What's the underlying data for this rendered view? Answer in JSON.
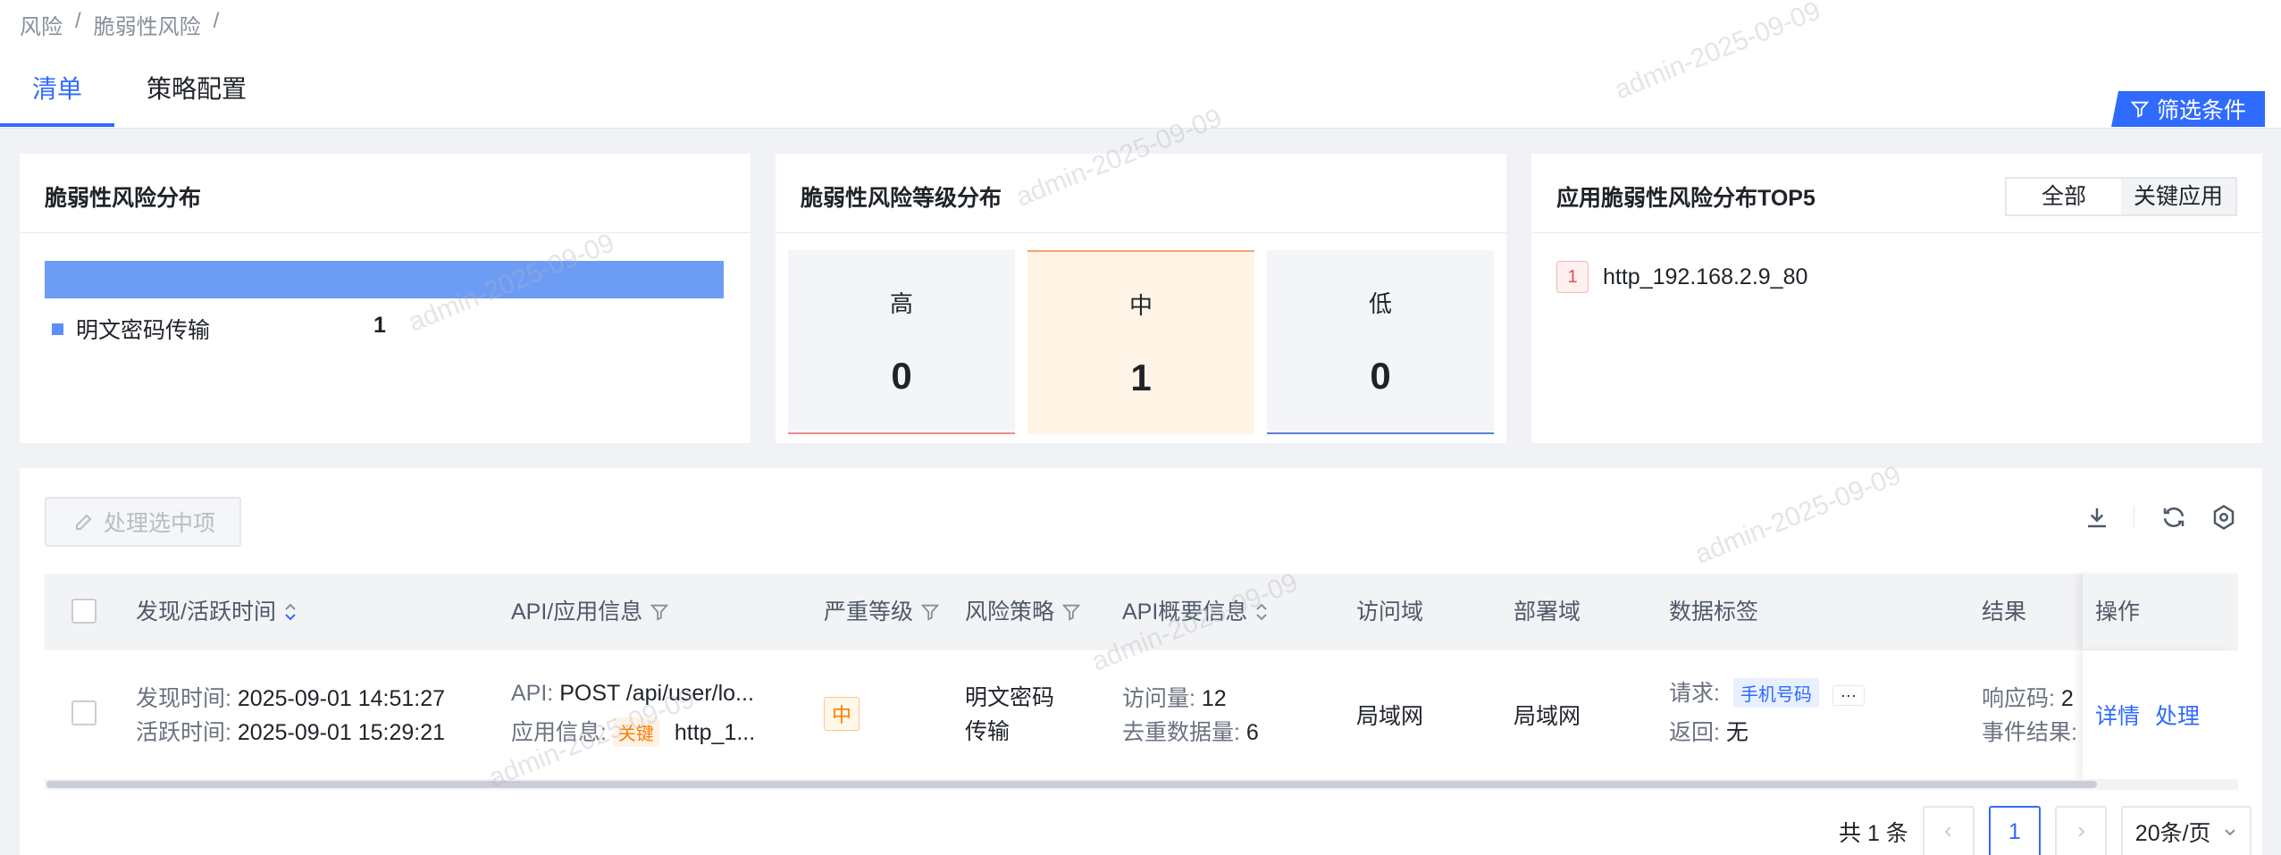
{
  "breadcrumb": [
    "风险",
    "/",
    "脆弱性风险",
    "/"
  ],
  "tabs": [
    {
      "label": "清单",
      "active": true
    },
    {
      "label": "策略配置",
      "active": false
    }
  ],
  "filter_button": {
    "label": "筛选条件"
  },
  "cards": {
    "distribution": {
      "title": "脆弱性风险分布",
      "legend": {
        "label": "明文密码传输",
        "value": "1"
      },
      "color": "#5b8ff9"
    },
    "levels": {
      "title": "脆弱性风险等级分布",
      "items": [
        {
          "label": "高",
          "value": "0",
          "bg": "#f4f5f8",
          "line": "#f08d8d"
        },
        {
          "label": "中",
          "value": "1",
          "bg": "#fff4e6",
          "line": "#f7a46a"
        },
        {
          "label": "低",
          "value": "0",
          "bg": "#f4f5f8",
          "line": "#5b7fe0"
        }
      ]
    },
    "top5": {
      "title": "应用脆弱性风险分布TOP5",
      "segments": [
        "全部",
        "关键应用"
      ],
      "items": [
        {
          "rank": "1",
          "name": "http_192.168.2.9_80"
        }
      ]
    }
  },
  "table": {
    "process_selected": "处理选中项",
    "columns": {
      "time": "发现/活跃时间",
      "api": "API/应用信息",
      "severity": "严重等级",
      "policy": "风险策略",
      "api_summary": "API概要信息",
      "access": "访问域",
      "deploy": "部署域",
      "data_tags": "数据标签",
      "result": "结果",
      "ops": "操作"
    },
    "row": {
      "found_label": "发现时间:",
      "found_time": "2025-09-01 14:51:27",
      "active_label": "活跃时间:",
      "active_time": "2025-09-01 15:29:21",
      "api_label": "API:",
      "api_value": "POST /api/user/lo...",
      "app_label": "应用信息:",
      "app_tag": "关键",
      "app_value": "http_1...",
      "severity": "中",
      "policy_line1": "明文密码",
      "policy_line2": "传输",
      "visits_label": "访问量:",
      "visits": "12",
      "dedup_label": "去重数据量:",
      "dedup": "6",
      "access": "局域网",
      "deploy": "局域网",
      "req_label": "请求:",
      "req_tag": "手机号码",
      "req_more": "···",
      "resp_label": "返回:",
      "resp_value": "无",
      "resp_code_label": "响应码:",
      "resp_code": "2",
      "event_label": "事件结果:",
      "detail": "详情",
      "handle": "处理"
    }
  },
  "pagination": {
    "total": "共 1 条",
    "current": "1",
    "page_size": "20条/页"
  },
  "watermark": "admin-2025-09-09"
}
